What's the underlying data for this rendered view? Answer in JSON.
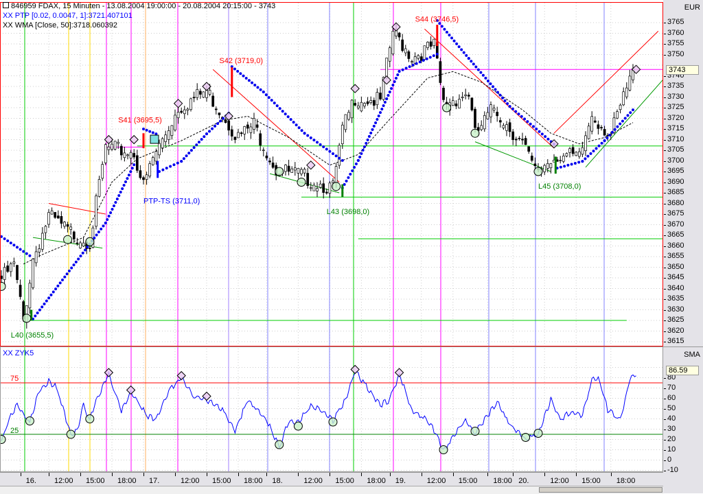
{
  "header": {
    "title": "846959  FDAX, 15 Minuten - 13.08.2004 19:00:00 - 20.08.2004 20:15:00 - 3743",
    "ptp": "XX PTP [0.02, 0.0047, 1]:3721.407101",
    "wma": "XX WMA [Close, 50]:3718.060392"
  },
  "price_axis": {
    "unit": "EUR",
    "current": "3743",
    "ticks": [
      "3765",
      "3760",
      "3755",
      "3750",
      "3745",
      "3740",
      "3735",
      "3730",
      "3725",
      "3720",
      "3715",
      "3710",
      "3705",
      "3700",
      "3695",
      "3690",
      "3685",
      "3680",
      "3675",
      "3670",
      "3665",
      "3660",
      "3655",
      "3650",
      "3645",
      "3640",
      "3635",
      "3630",
      "3625",
      "3620",
      "3615"
    ]
  },
  "osc_axis": {
    "unit": "SMA",
    "current": "86.59",
    "ticks": [
      "80",
      "70",
      "60",
      "50",
      "40",
      "30",
      "20",
      "10",
      "0",
      "-10"
    ]
  },
  "oscillator": {
    "name": "XX  ZYK5",
    "upper_label": "75",
    "lower_label": "25"
  },
  "time_axis": [
    {
      "bar": 6,
      "label": "16."
    },
    {
      "bar": 15,
      "label": "12:00"
    },
    {
      "bar": 25,
      "label": "15:00"
    },
    {
      "bar": 35,
      "label": "18:00"
    },
    {
      "bar": 45,
      "label": "17."
    },
    {
      "bar": 55,
      "label": "12:00"
    },
    {
      "bar": 65,
      "label": "15:00"
    },
    {
      "bar": 75,
      "label": "18:00"
    },
    {
      "bar": 84,
      "label": "18."
    },
    {
      "bar": 94,
      "label": "12:00"
    },
    {
      "bar": 104,
      "label": "15:00"
    },
    {
      "bar": 114,
      "label": "18:00"
    },
    {
      "bar": 123,
      "label": "19."
    },
    {
      "bar": 133,
      "label": "12:00"
    },
    {
      "bar": 143,
      "label": "15:00"
    },
    {
      "bar": 154,
      "label": "18:00"
    },
    {
      "bar": 162,
      "label": "20."
    },
    {
      "bar": 172,
      "label": "12:00"
    },
    {
      "bar": 182,
      "label": "15:00"
    },
    {
      "bar": 193,
      "label": "18:00"
    }
  ],
  "annotations": [
    {
      "text": "S41 (3695,5)",
      "bar": 37,
      "price": 3718,
      "color": "#ff0000"
    },
    {
      "text": "S42 (3719,0)",
      "bar": 69,
      "price": 3746,
      "color": "#ff0000"
    },
    {
      "text": "S44 (3746,5)",
      "bar": 131,
      "price": 3765.5,
      "color": "#ff0000"
    },
    {
      "text": "L40 (3655,5)",
      "bar": 3,
      "price": 3617,
      "color": "#008000"
    },
    {
      "text": "PTP-TS (3711,0)",
      "bar": 45,
      "price": 3680,
      "color": "#0000ff"
    },
    {
      "text": "L43 (3698,0)",
      "bar": 103,
      "price": 3675,
      "color": "#008000"
    },
    {
      "text": "L45 (3708,0)",
      "bar": 170,
      "price": 3687,
      "color": "#008000"
    }
  ],
  "colors": {
    "frame": "#ff0000",
    "ptp": "#0000ff",
    "up": "#ffffff",
    "down": "#000000",
    "osc": "#0000ff",
    "level_hi": "#ff0000",
    "level_lo": "#008000"
  },
  "chart_data": {
    "type": "candlestick",
    "title": "846959 FDAX, 15 Minuten",
    "ylabel": "EUR",
    "ylim": [
      3612,
      3770
    ],
    "price_keypoints": [
      [
        0,
        3646.6
      ],
      [
        4,
        3653
      ],
      [
        7,
        3627
      ],
      [
        10,
        3656
      ],
      [
        15,
        3676
      ],
      [
        21,
        3669
      ],
      [
        28,
        3664
      ],
      [
        33,
        3708
      ],
      [
        42,
        3706
      ],
      [
        45,
        3690
      ],
      [
        48,
        3703
      ],
      [
        56,
        3727
      ],
      [
        65,
        3735
      ],
      [
        71,
        3722
      ],
      [
        75,
        3713
      ],
      [
        80,
        3719
      ],
      [
        87,
        3698
      ],
      [
        95,
        3695
      ],
      [
        105,
        3689
      ],
      [
        108,
        3716
      ],
      [
        112,
        3732
      ],
      [
        120,
        3730
      ],
      [
        124,
        3763
      ],
      [
        130,
        3751
      ],
      [
        137,
        3756
      ],
      [
        140,
        3729
      ],
      [
        148,
        3734
      ],
      [
        150,
        3714
      ],
      [
        156,
        3727
      ],
      [
        165,
        3710
      ],
      [
        169,
        3697
      ],
      [
        176,
        3705
      ],
      [
        183,
        3703
      ],
      [
        187,
        3724
      ],
      [
        193,
        3714
      ],
      [
        199,
        3740
      ],
      [
        200,
        3743
      ]
    ],
    "ptp_segments": [
      [
        [
          0,
          3664.4
        ],
        [
          9,
          3655.4
        ]
      ],
      [
        [
          10,
          3625.7
        ],
        [
          33,
          3670.8
        ],
        [
          42,
          3698.2
        ]
      ],
      [
        [
          45,
          3715
        ],
        [
          49,
          3712.7
        ]
      ],
      [
        [
          50,
          3695
        ],
        [
          57,
          3699.8
        ],
        [
          65,
          3712.7
        ],
        [
          72,
          3722.4
        ]
      ],
      [
        [
          73,
          3744.3
        ],
        [
          83,
          3732.4
        ],
        [
          96,
          3713
        ],
        [
          108,
          3700.2
        ]
      ],
      [
        [
          108,
          3687.3
        ],
        [
          113,
          3700.2
        ],
        [
          122,
          3729.2
        ],
        [
          126,
          3742.1
        ],
        [
          138,
          3750.2
        ]
      ],
      [
        [
          138,
          3766
        ],
        [
          148,
          3748.2
        ],
        [
          161,
          3725.6
        ],
        [
          175,
          3707.9
        ]
      ],
      [
        [
          176,
          3696.6
        ],
        [
          184,
          3699.8
        ],
        [
          191,
          3709.5
        ],
        [
          200,
          3724
        ]
      ]
    ],
    "wma": [
      [
        7,
        3651.5
      ],
      [
        13,
        3656
      ],
      [
        26,
        3664
      ],
      [
        35,
        3690
      ],
      [
        43,
        3701
      ],
      [
        57,
        3709.5
      ],
      [
        70,
        3719
      ],
      [
        78,
        3721
      ],
      [
        91,
        3711
      ],
      [
        104,
        3698
      ],
      [
        113,
        3703
      ],
      [
        122,
        3718
      ],
      [
        135,
        3739
      ],
      [
        143,
        3742
      ],
      [
        152,
        3737
      ],
      [
        165,
        3724
      ],
      [
        174,
        3713
      ],
      [
        183,
        3708
      ],
      [
        191,
        3711
      ],
      [
        200,
        3718
      ]
    ],
    "red_trendlines": [
      [
        [
          15,
          3680
        ],
        [
          33,
          3675
        ]
      ],
      [
        [
          67,
          3743
        ],
        [
          107,
          3690
        ]
      ],
      [
        [
          134,
          3762
        ],
        [
          175,
          3706
        ]
      ],
      [
        [
          175,
          3713
        ],
        [
          208,
          3761
        ]
      ]
    ],
    "green_trendlines": [
      [
        [
          10,
          3664
        ],
        [
          32,
          3659
        ]
      ],
      [
        [
          85,
          3694
        ],
        [
          107,
          3685
        ]
      ],
      [
        [
          150,
          3709
        ],
        [
          174,
          3695
        ]
      ],
      [
        [
          185,
          3697
        ],
        [
          210,
          3739
        ]
      ]
    ],
    "levels": [
      {
        "price": 3743,
        "from": 120,
        "to": 210,
        "color": "#ff00ff"
      },
      {
        "price": 3706.5,
        "from": 33,
        "to": 45,
        "color": "#ff00ff"
      },
      {
        "price": 3707,
        "from": 43,
        "to": 210,
        "color": "#00cc00"
      },
      {
        "price": 3683,
        "from": 95,
        "to": 210,
        "color": "#00cc00"
      },
      {
        "price": 3663.4,
        "from": 113,
        "to": 210,
        "color": "#00cc00"
      },
      {
        "price": 3625,
        "from": 9,
        "to": 198,
        "color": "#00cc00"
      }
    ],
    "high_markers": [
      [
        34,
        3710
      ],
      [
        42,
        3710
      ],
      [
        56,
        3727
      ],
      [
        65,
        3735
      ],
      [
        72,
        3721
      ],
      [
        98,
        3698
      ],
      [
        112,
        3734
      ],
      [
        122,
        3738
      ],
      [
        125,
        3763
      ],
      [
        175,
        3708
      ],
      [
        201,
        3743
      ]
    ],
    "low_markers": [
      [
        0,
        3641
      ],
      [
        8,
        3626
      ],
      [
        21,
        3663
      ],
      [
        28,
        3662
      ],
      [
        88,
        3695
      ],
      [
        95,
        3690
      ],
      [
        106,
        3688
      ],
      [
        141,
        3725
      ],
      [
        150,
        3713
      ],
      [
        170,
        3695
      ]
    ],
    "signal_bars": [
      {
        "bar": 45,
        "from": 3706,
        "to": 3713,
        "color": "#ff0000"
      },
      {
        "bar": 73,
        "from": 3730,
        "to": 3744,
        "color": "#ff0000"
      },
      {
        "bar": 138,
        "from": 3754,
        "to": 3764,
        "color": "#ff0000"
      },
      {
        "bar": 49.5,
        "from": 3692,
        "to": 3700,
        "color": "#0000ff"
      },
      {
        "bar": 9.5,
        "from": 3625,
        "to": 3630,
        "color": "#008000"
      },
      {
        "bar": 108,
        "from": 3683,
        "to": 3689,
        "color": "#008000"
      },
      {
        "bar": 175.5,
        "from": 3694,
        "to": 3702,
        "color": "#008000"
      }
    ],
    "oscillator": {
      "ylim": [
        -10,
        90
      ],
      "levels": [
        75,
        25
      ],
      "keypoints": [
        [
          0,
          20
        ],
        [
          3,
          45
        ],
        [
          5,
          55
        ],
        [
          9,
          38
        ],
        [
          12,
          70
        ],
        [
          15,
          78
        ],
        [
          17,
          73
        ],
        [
          19,
          58
        ],
        [
          22,
          25
        ],
        [
          24,
          30
        ],
        [
          26,
          55
        ],
        [
          28,
          40
        ],
        [
          30,
          60
        ],
        [
          34,
          85
        ],
        [
          38,
          50
        ],
        [
          41,
          68
        ],
        [
          46,
          45
        ],
        [
          49,
          40
        ],
        [
          53,
          68
        ],
        [
          57,
          82
        ],
        [
          61,
          62
        ],
        [
          65,
          60
        ],
        [
          70,
          50
        ],
        [
          74,
          30
        ],
        [
          78,
          60
        ],
        [
          84,
          40
        ],
        [
          88,
          15
        ],
        [
          91,
          40
        ],
        [
          94,
          38
        ],
        [
          98,
          55
        ],
        [
          102,
          48
        ],
        [
          105,
          40
        ],
        [
          109,
          60
        ],
        [
          112,
          88
        ],
        [
          115,
          75
        ],
        [
          120,
          55
        ],
        [
          123,
          60
        ],
        [
          126,
          85
        ],
        [
          130,
          50
        ],
        [
          135,
          40
        ],
        [
          138,
          25
        ],
        [
          140,
          10
        ],
        [
          143,
          25
        ],
        [
          147,
          40
        ],
        [
          150,
          28
        ],
        [
          154,
          45
        ],
        [
          157,
          58
        ],
        [
          160,
          40
        ],
        [
          163,
          30
        ],
        [
          166,
          22
        ],
        [
          170,
          26
        ],
        [
          172,
          45
        ],
        [
          174,
          60
        ],
        [
          177,
          40
        ],
        [
          180,
          48
        ],
        [
          184,
          45
        ],
        [
          187,
          80
        ],
        [
          189,
          82
        ],
        [
          192,
          50
        ],
        [
          196,
          40
        ],
        [
          199,
          80
        ],
        [
          201,
          86
        ]
      ],
      "high_markers": [
        [
          34,
          85
        ],
        [
          41,
          68
        ],
        [
          57,
          82
        ],
        [
          65,
          62
        ],
        [
          112,
          88
        ],
        [
          126,
          85
        ]
      ],
      "low_markers": [
        [
          0,
          20
        ],
        [
          9,
          38
        ],
        [
          22,
          25
        ],
        [
          28,
          40
        ],
        [
          88,
          15
        ],
        [
          94,
          33
        ],
        [
          105,
          37
        ],
        [
          140,
          10
        ],
        [
          150,
          28
        ],
        [
          166,
          22
        ],
        [
          170,
          26
        ]
      ]
    }
  }
}
